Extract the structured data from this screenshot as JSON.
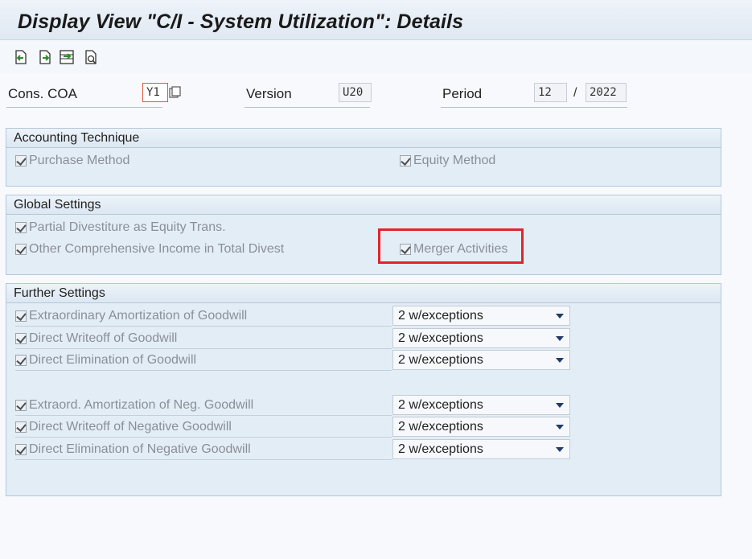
{
  "title": "Display View \"C/I - System Utilization\": Details",
  "toolbar": {
    "icons": [
      "previous-entry-icon",
      "next-entry-icon",
      "select-entry-icon",
      "other-entry-icon"
    ]
  },
  "header": {
    "cons_coa_label": "Cons. COA",
    "cons_coa_value": "Y1",
    "version_label": "Version",
    "version_value": "U20",
    "period_label": "Period",
    "period_value": "12",
    "period_sep": "/",
    "year_value": "2022"
  },
  "accounting_technique": {
    "title": "Accounting Technique",
    "purchase_method": "Purchase Method",
    "equity_method": "Equity Method"
  },
  "global_settings": {
    "title": "Global Settings",
    "partial_divestiture": "Partial Divestiture as Equity Trans.",
    "other_comprehensive": "Other Comprehensive Income in Total Divest",
    "merger_activities": "Merger Activities"
  },
  "further_settings": {
    "title": "Further Settings",
    "rows": [
      {
        "label": "Extraordinary Amortization of Goodwill",
        "value": "2 w/exceptions"
      },
      {
        "label": "Direct Writeoff of Goodwill",
        "value": "2 w/exceptions"
      },
      {
        "label": "Direct Elimination of Goodwill",
        "value": "2 w/exceptions"
      },
      {
        "label": "Extraord. Amortization of Neg. Goodwill",
        "value": "2 w/exceptions"
      },
      {
        "label": "Direct Writeoff of Negative Goodwill",
        "value": "2 w/exceptions"
      },
      {
        "label": "Direct Elimination of Negative Goodwill",
        "value": "2 w/exceptions"
      }
    ]
  },
  "colors": {
    "highlight": "#e0242d",
    "group_bg": "#e3edf6",
    "group_border": "#b3c8dc"
  }
}
